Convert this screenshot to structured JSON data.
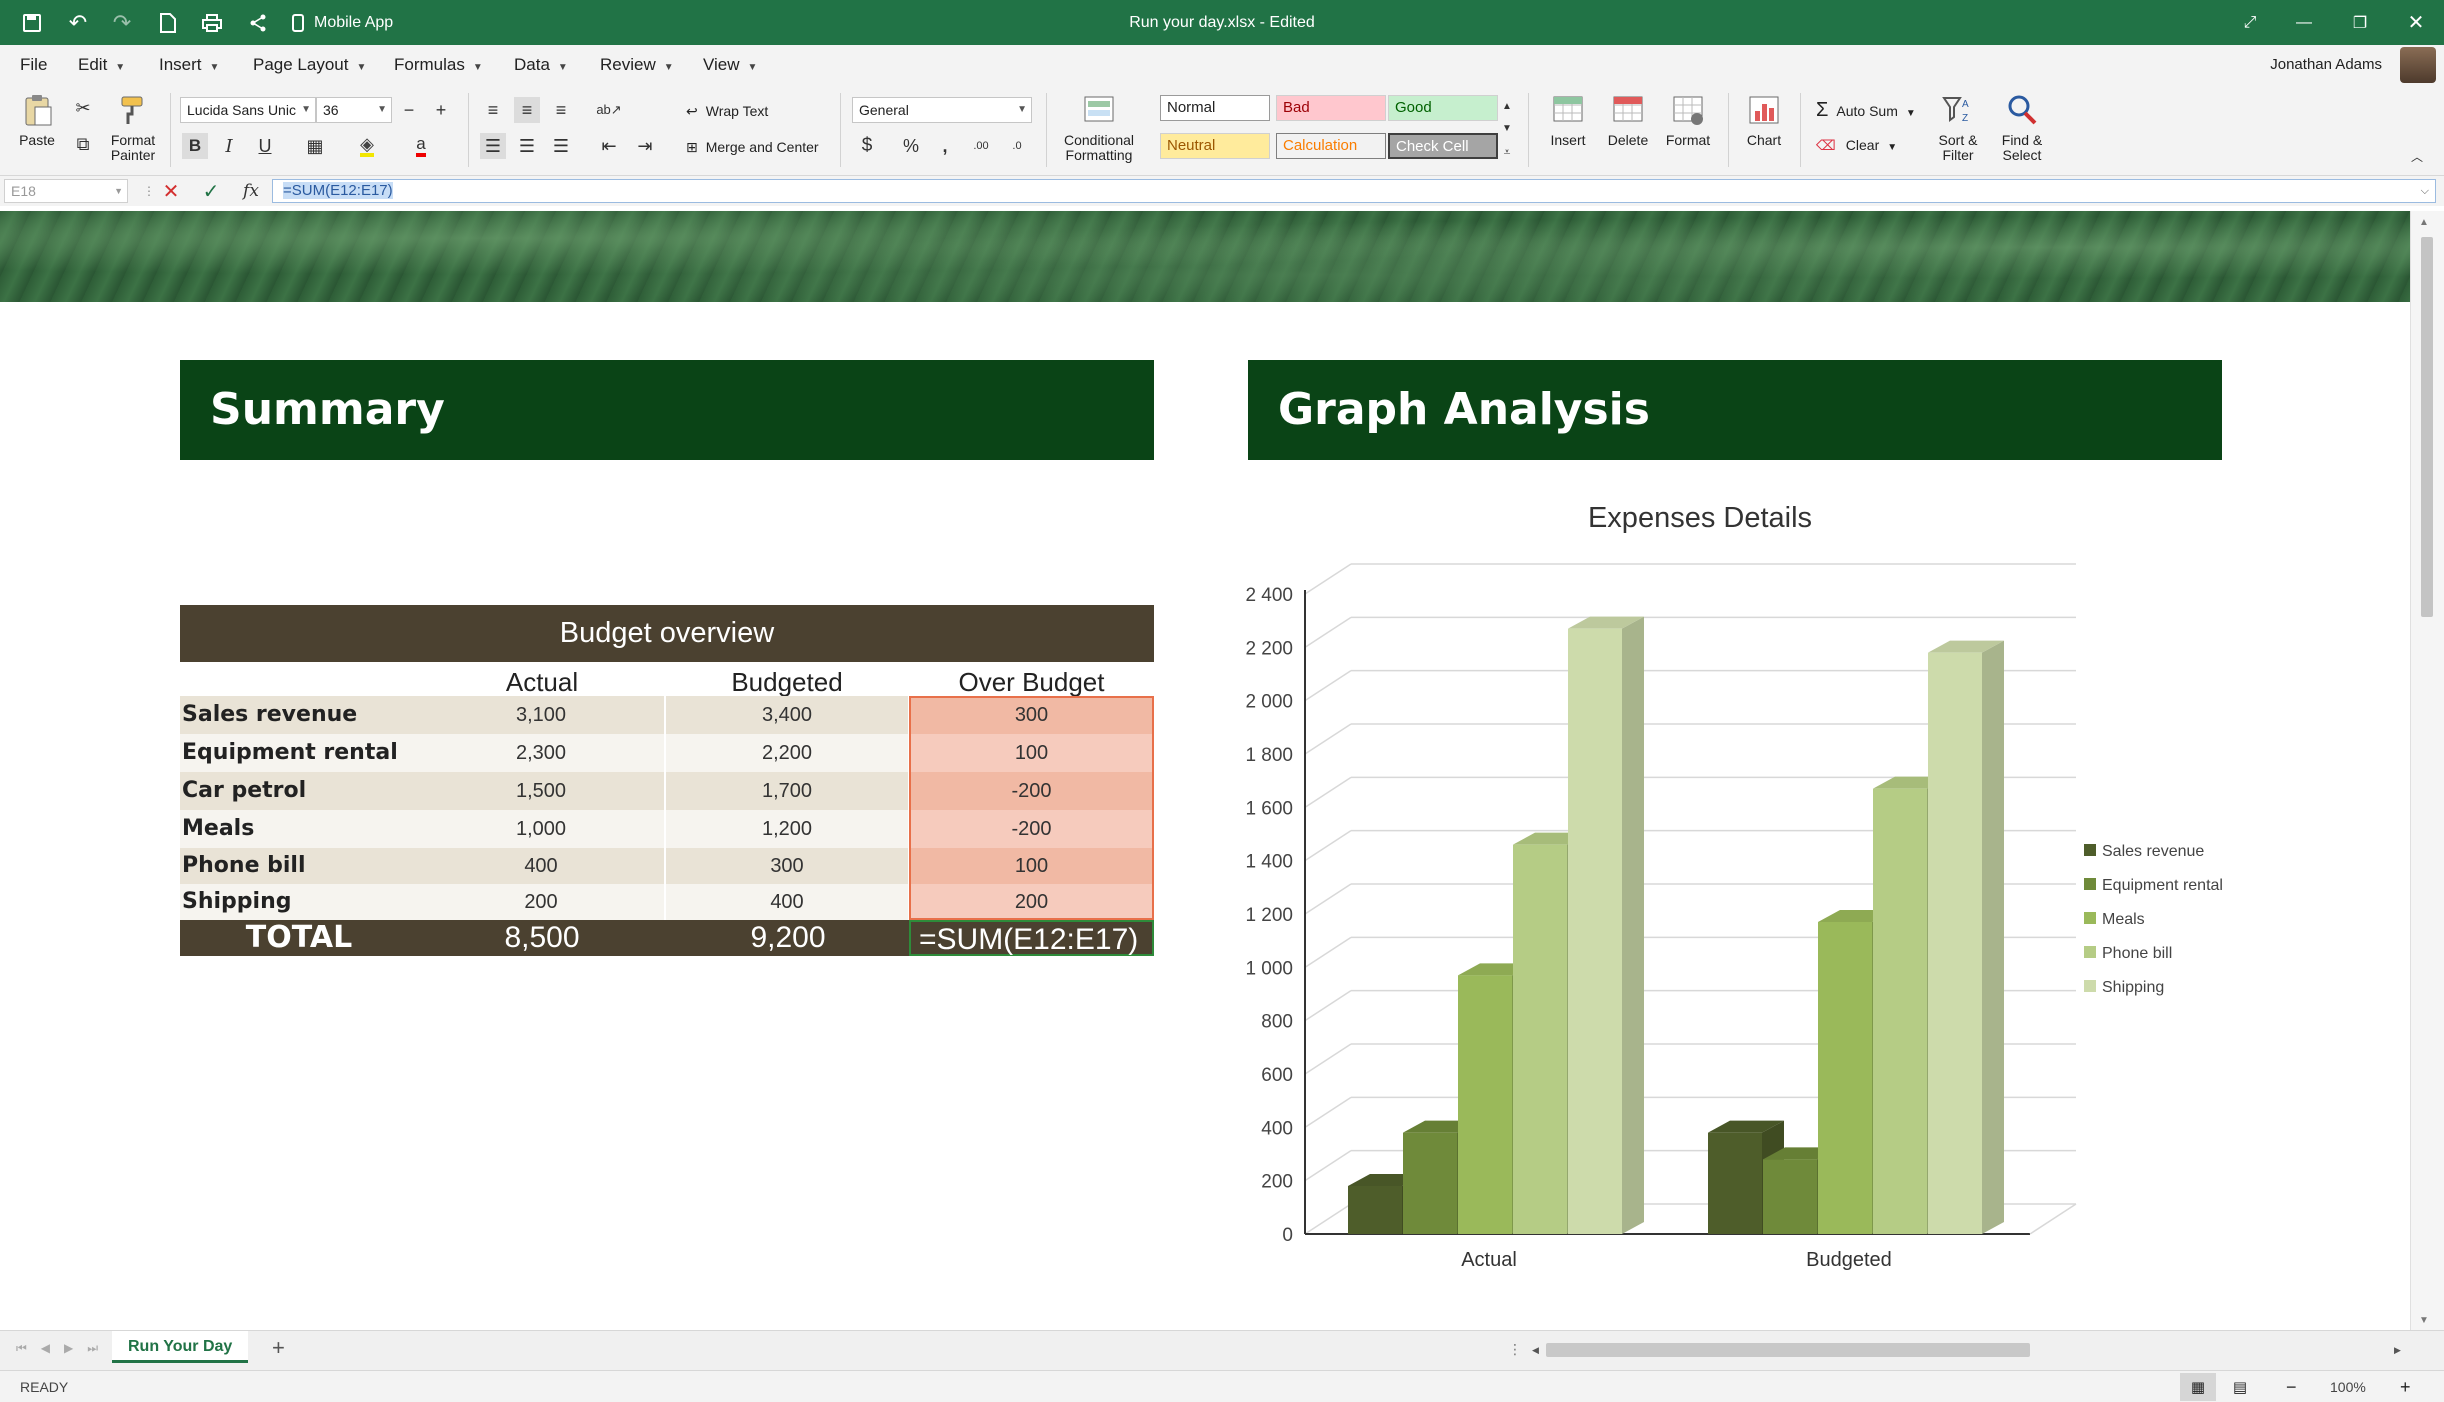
{
  "app": {
    "title": "Run your day.xlsx - Edited",
    "mobile_label": "Mobile App",
    "user_name": "Jonathan Adams"
  },
  "menu": [
    "File",
    "Edit",
    "Insert",
    "Page Layout",
    "Formulas",
    "Data",
    "Review",
    "View"
  ],
  "ribbon": {
    "paste": "Paste",
    "format_painter": "Format Painter",
    "font_name": "Lucida Sans Unic",
    "font_size": "36",
    "wrap_text": "Wrap Text",
    "merge_center": "Merge and Center",
    "number_format": "General",
    "conditional_formatting": "Conditional Formatting",
    "styles": {
      "normal": "Normal",
      "bad": "Bad",
      "good": "Good",
      "neutral": "Neutral",
      "calculation": "Calculation",
      "check_cell": "Check Cell"
    },
    "insert": "Insert",
    "delete": "Delete",
    "format": "Format",
    "chart": "Chart",
    "auto_sum": "Auto Sum",
    "clear": "Clear",
    "sort_filter": "Sort & Filter",
    "find_select": "Find & Select",
    "currency": "$",
    "percent": "%",
    "comma": ","
  },
  "formula_bar": {
    "cell_ref": "E18",
    "formula": "=SUM(E12:E17)"
  },
  "sheet": {
    "summary_header": "Summary",
    "graph_header": "Graph Analysis",
    "budget": {
      "title": "Budget overview",
      "columns": [
        "Actual",
        "Budgeted",
        "Over Budget"
      ],
      "rows": [
        {
          "label": "Sales revenue",
          "actual": "3,100",
          "budgeted": "3,400",
          "over": "300"
        },
        {
          "label": "Equipment rental",
          "actual": "2,300",
          "budgeted": "2,200",
          "over": "100"
        },
        {
          "label": "Car petrol",
          "actual": "1,500",
          "budgeted": "1,700",
          "over": "-200"
        },
        {
          "label": "Meals",
          "actual": "1,000",
          "budgeted": "1,200",
          "over": "-200"
        },
        {
          "label": "Phone bill",
          "actual": "400",
          "budgeted": "300",
          "over": "100"
        },
        {
          "label": "Shipping",
          "actual": "200",
          "budgeted": "400",
          "over": "200"
        }
      ],
      "total": {
        "label": "TOTAL",
        "actual": "8,500",
        "budgeted": "9,200",
        "over": "=SUM(E12:E17)"
      }
    }
  },
  "chart_data": {
    "type": "bar",
    "title": "Expenses Details",
    "categories": [
      "Actual",
      "Budgeted"
    ],
    "series": [
      {
        "name": "Sales revenue",
        "values": [
          180,
          380
        ],
        "color": "#4e5d2a"
      },
      {
        "name": "Equipment rental",
        "values": [
          380,
          280
        ],
        "color": "#6f8a3a"
      },
      {
        "name": "Meals",
        "values": [
          970,
          1170
        ],
        "color": "#9ab95a"
      },
      {
        "name": "Phone bill",
        "values": [
          1460,
          1670
        ],
        "color": "#b5cc85"
      },
      {
        "name": "Shipping",
        "values": [
          2270,
          2180
        ],
        "color": "#cddbab"
      }
    ],
    "ylim": [
      0,
      2400
    ],
    "yticks": [
      "0",
      "200",
      "400",
      "600",
      "800",
      "1 000",
      "1 200",
      "1 400",
      "1 600",
      "1 800",
      "2 000",
      "2 200",
      "2 400"
    ],
    "legend": "right"
  },
  "sheet_tab": "Run Your Day",
  "status": {
    "ready": "READY",
    "zoom": "100%"
  }
}
